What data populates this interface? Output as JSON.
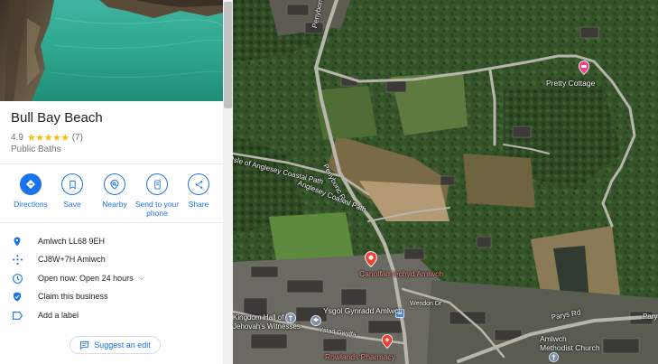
{
  "place": {
    "name": "Bull Bay Beach",
    "rating": "4.9",
    "stars": "★★★★★",
    "review_count": "(7)",
    "category": "Public Baths"
  },
  "actions": [
    {
      "label": "Directions",
      "icon": "directions-icon"
    },
    {
      "label": "Save",
      "icon": "bookmark-icon"
    },
    {
      "label": "Nearby",
      "icon": "nearby-icon"
    },
    {
      "label": "Send to your\nphone",
      "line1": "Send to your",
      "line2": "phone",
      "icon": "phone-icon"
    },
    {
      "label": "Share",
      "icon": "share-icon"
    }
  ],
  "info": {
    "address": "Amlwch LL68 9EH",
    "plus_code": "CJ8W+7H Amlwch",
    "hours_status": "Open now:",
    "hours_value": "Open 24 hours",
    "claim": "Claim this business",
    "add_label": "Add a label"
  },
  "suggest_edit": "Suggest an edit",
  "map": {
    "labels": {
      "pretty_cottage": "Pretty Cottage",
      "pen_y_bonc": "Penybonc Rd",
      "coastal_path_1": "Isle of Anglesey Coastal Path",
      "coastal_path_2": "Anglesey Coastal Path",
      "pen_y_bonc_2": "Penybonc Rd",
      "canolfan": "Canolfan Iechyd Amlwch",
      "kingdom_hall_1": "Kingdom Hall of",
      "kingdom_hall_2": "Jehovah's Witnesses",
      "ysgol": "Ysgol Gynradd Amlwch",
      "wendon": "Wendon Dr",
      "parys_rd_1": "Parys Rd",
      "parys_rd_2": "Parys Rd",
      "amlwch_methodist_1": "Amlwch",
      "amlwch_methodist_2": "Methodist Church",
      "ystad_gwylfa": "Ystad Gwylfa",
      "rowlands": "Rowlands Pharmacy"
    }
  },
  "colors": {
    "accent": "#1a73e8",
    "star": "#fbbc04",
    "secondary_text": "#70757a",
    "divider": "#e8eaed",
    "map_pin_pink": "#e8448a",
    "map_pin_red": "#ea4335"
  }
}
